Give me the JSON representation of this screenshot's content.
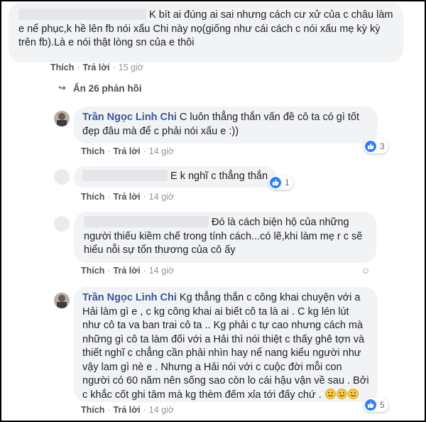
{
  "comments": [
    {
      "text": "K bít ai đúng ai sai nhưng cách cư xử của c châu làm e nể phục,k hề lên fb nói xấu Chi này nọ(giống như cái cách c nói xấu mẹ kỳ kỳ trên fb).Là e nói thật lòng sn của e thôi",
      "like": "Thích",
      "reply": "Trả lời",
      "time": "15 giờ"
    }
  ],
  "hidden_replies": "Ẩn 26 phản hồi",
  "replies": [
    {
      "author": "Trần Ngọc Linh Chi",
      "text": "C luôn thẳng thắn vấn đề cô ta có gì tốt đẹp đâu mà để c phải nói xấu e :))",
      "like": "Thích",
      "reply": "Trả lời",
      "time": "14 giờ",
      "reactions": "3"
    },
    {
      "text": "E k nghĩ c thẳng thắn",
      "like": "Thích",
      "reply": "Trả lời",
      "time": "14 giờ",
      "reactions": "1"
    },
    {
      "text": "Đó là cách biện hộ của những người thiếu kiềm chế trong tính cách...có lẽ,khi làm mẹ r c sẽ hiểu nỗi sự tổn thương của cô ấy",
      "like": "Thích",
      "reply": "Trả lời",
      "time": "14 giờ"
    },
    {
      "author": "Trần Ngọc Linh Chi",
      "text": "Kg thẳng thắn c công khai chuyện với a Hải làm gì e , c kg công khai ai biết cô ta là ai . C kg lén lút như cô ta va ban trai cô ta .. Kg phải c tự cao nhưng cách mà những gì cô ta làm đối với a Hải thì nói thiệt c thấy ghê tợn và thiết nghĩ c chẳng cần phải nhìn hay nể nang kiểu người như vậy lam gì nè e . Nhưng a Hải nói với c cuộc đời mỗi con người có 60 năm nên sống sao còn lo cái hậu vận về sau . Bởi c khắc cốt ghi tâm mà kg thèm đếm xỉa tới đấy chứ .",
      "like": "Thích",
      "reply": "Trả lời",
      "time": "14 giờ",
      "reactions": "5"
    }
  ],
  "colors": {
    "name": "#365899",
    "bubble": "#f2f3f5",
    "like": "#2e82f6"
  }
}
